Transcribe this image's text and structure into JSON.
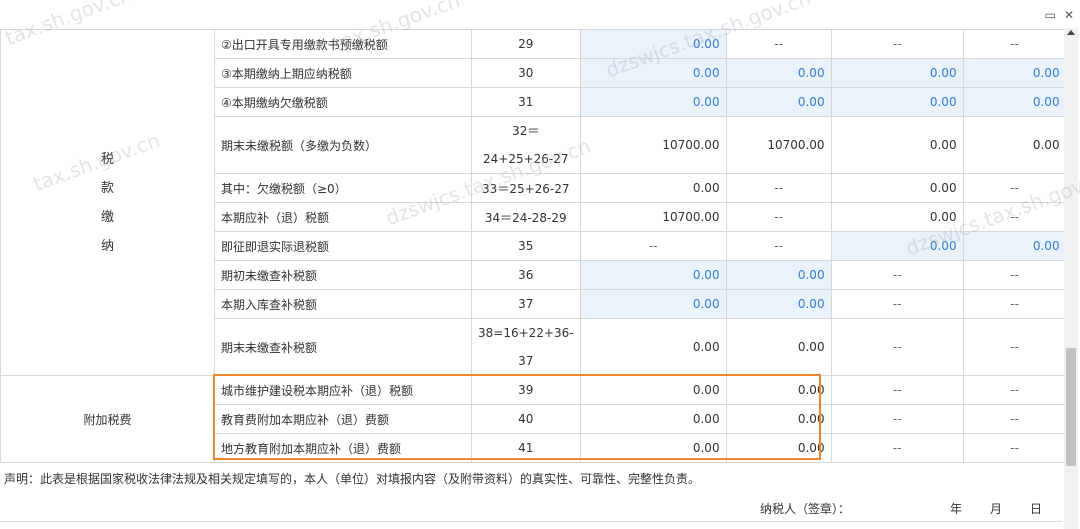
{
  "window": {
    "maximize_icon": "maximize-icon",
    "close_icon": "close-icon"
  },
  "section_tax_payment": {
    "label_chars": [
      "税",
      "款",
      "缴",
      "纳"
    ]
  },
  "section_surcharge": {
    "label": "附加税费"
  },
  "rows": [
    {
      "name": "②出口开具专用缴款书预缴税额",
      "code": "29",
      "c1": "0.00",
      "c2": "--",
      "c3": "--",
      "c4": "--"
    },
    {
      "name": "③本期缴纳上期应纳税额",
      "code": "30",
      "c1": "0.00",
      "c2": "0.00",
      "c3": "0.00",
      "c4": "0.00"
    },
    {
      "name": "④本期缴纳欠缴税额",
      "code": "31",
      "c1": "0.00",
      "c2": "0.00",
      "c3": "0.00",
      "c4": "0.00"
    },
    {
      "name": "期末未缴税额（多缴为负数）",
      "code": "32＝24+25+26-27",
      "c1": "10700.00",
      "c2": "10700.00",
      "c3": "0.00",
      "c4": "0.00"
    },
    {
      "name": "其中：欠缴税额（≥0）",
      "code": "33＝25+26-27",
      "c1": "0.00",
      "c2": "--",
      "c3": "0.00",
      "c4": "--"
    },
    {
      "name": "本期应补（退）税额",
      "code": "34＝24-28-29",
      "c1": "10700.00",
      "c2": "--",
      "c3": "0.00",
      "c4": "--"
    },
    {
      "name": "即征即退实际退税额",
      "code": "35",
      "c1": "--",
      "c2": "--",
      "c3": "0.00",
      "c4": "0.00"
    },
    {
      "name": "期初未缴查补税额",
      "code": "36",
      "c1": "0.00",
      "c2": "0.00",
      "c3": "--",
      "c4": "--"
    },
    {
      "name": "本期入库查补税额",
      "code": "37",
      "c1": "0.00",
      "c2": "0.00",
      "c3": "--",
      "c4": "--"
    },
    {
      "name": "期末未缴查补税额",
      "code": "38=16+22+36-37",
      "c1": "0.00",
      "c2": "0.00",
      "c3": "--",
      "c4": "--"
    },
    {
      "name": "城市维护建设税本期应补（退）税额",
      "code": "39",
      "c1": "0.00",
      "c2": "0.00",
      "c3": "--",
      "c4": "--"
    },
    {
      "name": "教育费附加本期应补（退）费额",
      "code": "40",
      "c1": "0.00",
      "c2": "0.00",
      "c3": "--",
      "c4": "--"
    },
    {
      "name": "地方教育附加本期应补（退）费额",
      "code": "41",
      "c1": "0.00",
      "c2": "0.00",
      "c3": "--",
      "c4": "--"
    }
  ],
  "declaration": {
    "statement": "声明：此表是根据国家税收法律法规及相关规定填写的，本人（单位）对填报内容（及附带资料）的真实性、可靠性、完整性负责。",
    "signature": "纳税人（签章）：",
    "year": "年",
    "month": "月",
    "day": "日"
  },
  "watermarks": [
    "tax.sh.gov.cn",
    "dzswjcs.tax.sh.gov.cn"
  ],
  "colors": {
    "editable_bg": "#eaf2fb",
    "editable_text": "#2f7ed8",
    "highlight": "#f0852c"
  }
}
